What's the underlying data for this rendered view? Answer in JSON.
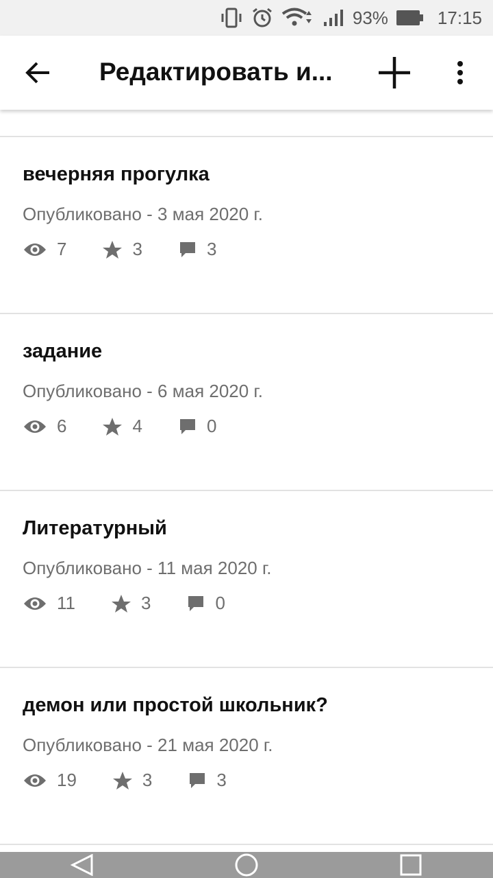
{
  "status_bar": {
    "battery_percent": "93%",
    "time": "17:15",
    "icons": [
      "vibrate-icon",
      "alarm-icon",
      "wifi-icon",
      "signal-icon",
      "battery-icon"
    ]
  },
  "app_bar": {
    "title": "Редактировать и...",
    "icons": [
      "back-arrow-icon",
      "plus-icon",
      "more-vert-icon"
    ]
  },
  "posts": [
    {
      "title": "вечерняя прогулка",
      "date": "Опубликовано - 3 мая 2020 г.",
      "views": "7",
      "stars": "3",
      "comments": "3"
    },
    {
      "title": "задание",
      "date": "Опубликовано - 6 мая 2020 г.",
      "views": "6",
      "stars": "4",
      "comments": "0"
    },
    {
      "title": "Литературный",
      "date": "Опубликовано - 11 мая 2020 г.",
      "views": "11",
      "stars": "3",
      "comments": "0"
    },
    {
      "title": "демон или простой школьник?",
      "date": "Опубликовано - 21 мая 2020 г.",
      "views": "19",
      "stars": "3",
      "comments": "3"
    }
  ],
  "nav_bar": {
    "icons": [
      "back-triangle-icon",
      "home-circle-icon",
      "recents-square-icon"
    ]
  },
  "colors": {
    "text_primary": "#111111",
    "text_secondary": "#6e6e6e",
    "divider": "#e2e2e2",
    "nav_bar": "#9b9b9b"
  }
}
